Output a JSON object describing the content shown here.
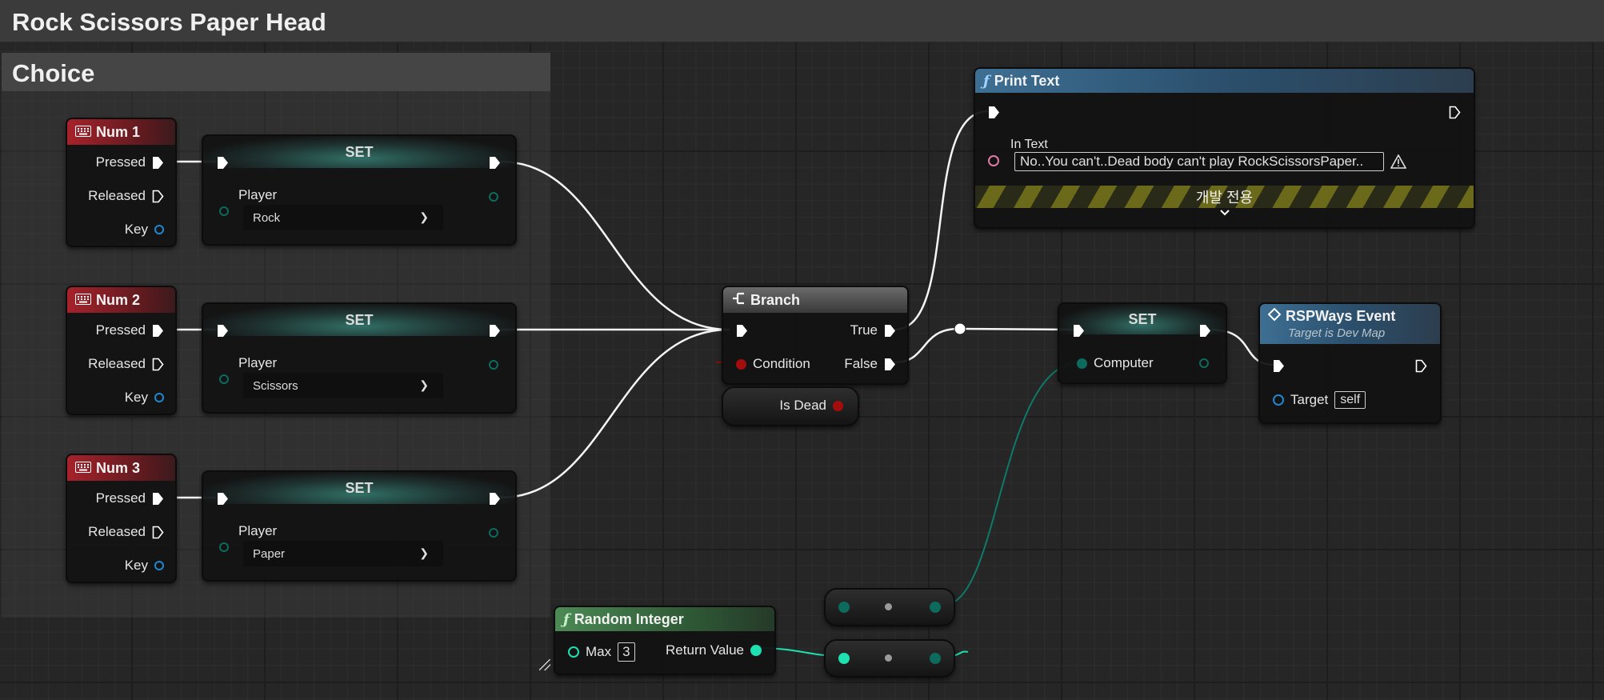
{
  "graph_title": "Rock Scissors Paper Head",
  "comment_title": "Choice",
  "keys": [
    {
      "title": "Num 1",
      "pressed": "Pressed",
      "released": "Released",
      "key": "Key"
    },
    {
      "title": "Num 2",
      "pressed": "Pressed",
      "released": "Released",
      "key": "Key"
    },
    {
      "title": "Num 3",
      "pressed": "Pressed",
      "released": "Released",
      "key": "Key"
    }
  ],
  "set_nodes": [
    {
      "title": "SET",
      "var": "Player",
      "value": "Rock"
    },
    {
      "title": "SET",
      "var": "Player",
      "value": "Scissors"
    },
    {
      "title": "SET",
      "var": "Player",
      "value": "Paper"
    }
  ],
  "branch": {
    "title": "Branch",
    "true_label": "True",
    "false_label": "False",
    "condition": "Condition"
  },
  "is_dead": "Is Dead",
  "print_text": {
    "title": "Print Text",
    "in_text_label": "In Text",
    "in_text_value": "No..You can't..Dead body can't play RockScissorsPaper..",
    "dev_only": "개발 전용"
  },
  "set_computer": {
    "title": "SET",
    "var": "Computer"
  },
  "rsp_event": {
    "title": "RSPWays Event",
    "subtitle": "Target is Dev Map",
    "target_label": "Target",
    "target_value": "self"
  },
  "random_integer": {
    "title": "Random Integer",
    "max_label": "Max",
    "max_value": "3",
    "return_label": "Return Value"
  },
  "colors": {
    "exec": "#ffffff",
    "bool": "#a30d0d",
    "int": "#1fe0b0",
    "byte": "#0d6b5e",
    "object": "#1e88d0",
    "string": "#e07ba5"
  }
}
